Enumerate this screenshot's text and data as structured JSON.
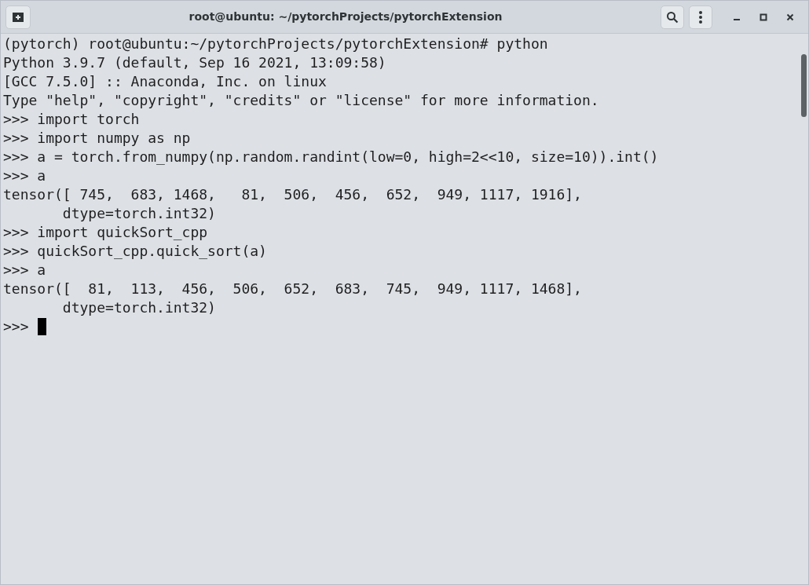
{
  "window": {
    "title": "root@ubuntu: ~/pytorchProjects/pytorchExtension"
  },
  "terminal": {
    "lines": [
      "(pytorch) root@ubuntu:~/pytorchProjects/pytorchExtension# python",
      "Python 3.9.7 (default, Sep 16 2021, 13:09:58)",
      "[GCC 7.5.0] :: Anaconda, Inc. on linux",
      "Type \"help\", \"copyright\", \"credits\" or \"license\" for more information.",
      ">>> import torch",
      ">>> import numpy as np",
      ">>> a = torch.from_numpy(np.random.randint(low=0, high=2<<10, size=10)).int()",
      ">>> a",
      "tensor([ 745,  683, 1468,   81,  506,  456,  652,  949, 1117, 1916],",
      "       dtype=torch.int32)",
      ">>> import quickSort_cpp",
      ">>> quickSort_cpp.quick_sort(a)",
      ">>> a",
      "tensor([  81,  113,  456,  506,  652,  683,  745,  949, 1117, 1468],",
      "       dtype=torch.int32)"
    ],
    "prompt": ">>>"
  }
}
